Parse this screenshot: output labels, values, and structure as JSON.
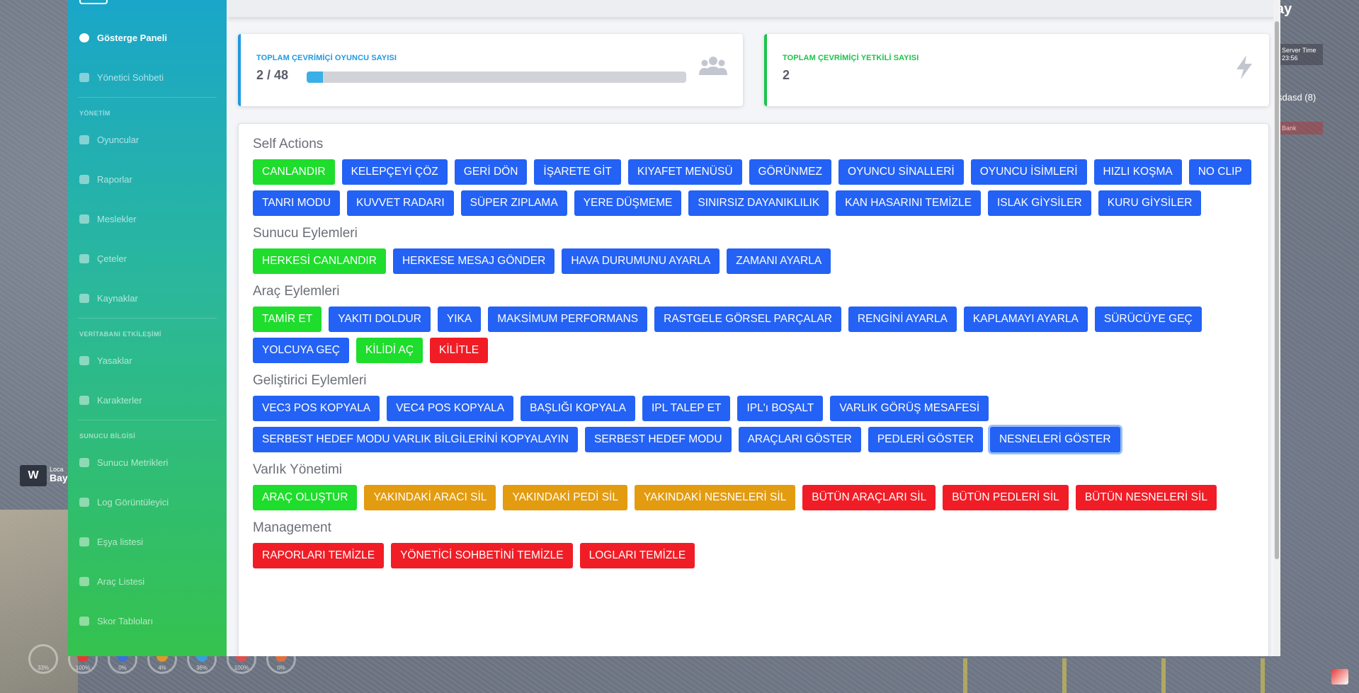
{
  "sidebar": {
    "items": [
      {
        "label": "Gösterge Paneli"
      },
      {
        "label": "Yönetici Sohbeti"
      },
      {
        "label": "Oyuncular"
      },
      {
        "label": "Raporlar"
      },
      {
        "label": "Meslekler"
      },
      {
        "label": "Çeteler"
      },
      {
        "label": "Kaynaklar"
      },
      {
        "label": "Yasaklar"
      },
      {
        "label": "Karakterler"
      },
      {
        "label": "Sunucu Metrikleri"
      },
      {
        "label": "Log Görüntüleyici"
      },
      {
        "label": "Eşya listesi"
      },
      {
        "label": "Araç Listesi"
      },
      {
        "label": "Skor Tabloları"
      }
    ],
    "headings": [
      "YÖNETİM",
      "VERİTABANI ETKİLEŞİMİ",
      "SUNUCU BİLGİSİ"
    ]
  },
  "stats": {
    "online_players_label": "TOPLAM ÇEVRİMİÇİ OYUNCU SAYISI",
    "online_players_value": "2 / 48",
    "online_players_fraction": 0.042,
    "online_admins_label": "TOPLAM ÇEVRİMİÇİ YETKİLİ SAYISI",
    "online_admins_value": "2"
  },
  "sections": {
    "self": {
      "title": "Self Actions",
      "buttons": [
        "CANLANDIR",
        "KELEPÇEYİ ÇÖZ",
        "GERİ DÖN",
        "İŞARETE GİT",
        "KIYAFET MENÜSÜ",
        "GÖRÜNMEZ",
        "OYUNCU SİNALLERİ",
        "OYUNCU İSİMLERİ",
        "HIZLI KOŞMA",
        "NO CLIP",
        "TANRI MODU",
        "KUVVET RADARI",
        "SÜPER ZIPLAMA",
        "YERE DÜŞMEME",
        "SINIRSIZ DAYANIKLILIK",
        "KAN HASARINI TEMİZLE",
        "ISLAK GİYSİLER",
        "KURU GİYSİLER"
      ]
    },
    "server": {
      "title": "Sunucu Eylemleri",
      "buttons": [
        "HERKESİ CANLANDIR",
        "HERKESE MESAJ GÖNDER",
        "HAVA DURUMUNU AYARLA",
        "ZAMANI AYARLA"
      ]
    },
    "vehicle": {
      "title": "Araç Eylemleri",
      "buttons": [
        "TAMİR ET",
        "YAKITI DOLDUR",
        "YIKA",
        "MAKSİMUM PERFORMANS",
        "RASTGELE GÖRSEL PARÇALAR",
        "RENGİNİ AYARLA",
        "KAPLAMAYI AYARLA",
        "SÜRÜCÜYE GEÇ",
        "YOLCUYA GEÇ",
        "KİLİDİ AÇ",
        "KİLİTLE"
      ]
    },
    "developer": {
      "title": "Geliştirici Eylemleri",
      "buttons": [
        "VEC3 POS KOPYALA",
        "VEC4 POS KOPYALA",
        "BAŞLIĞI KOPYALA",
        "IPL TALEP ET",
        "IPL'ı BOŞALT",
        "VARLIK GÖRÜŞ MESAFESİ",
        "SERBEST HEDEF MODU VARLIK BİLGİLERİNİ KOPYALAYIN",
        "SERBEST HEDEF MODU",
        "ARAÇLARI GÖSTER",
        "PEDLERİ GÖSTER",
        "NESNELERİ GÖSTER"
      ]
    },
    "entity": {
      "title": "Varlık Yönetimi",
      "buttons": [
        "ARAÇ OLUŞTUR",
        "YAKINDAKİ ARACI SİL",
        "YAKINDAKİ PEDİ SİL",
        "YAKINDAKİ NESNELERİ SİL",
        "BÜTÜN ARAÇLARI SİL",
        "BÜTÜN PEDLERİ SİL",
        "BÜTÜN NESNELERİ SİL"
      ]
    },
    "management": {
      "title": "Management",
      "buttons": [
        "RAPORLARI TEMİZLE",
        "YÖNETİCİ SOHBETİNİ TEMİZLE",
        "LOGLARI TEMİZLE"
      ]
    }
  },
  "hud": {
    "compass": "W",
    "location_label": "Loca",
    "location_name": "Bay",
    "day": "ay",
    "server_time_label": "Server Time",
    "server_time": "23:56",
    "player": "sdasd (8)",
    "bank_label": "Bank",
    "status": [
      "33%",
      "100%",
      "0%",
      "4%",
      "36%",
      "100%",
      "0%"
    ]
  },
  "colors": {
    "primary_blue": "#2462f5",
    "success_green": "#1edd2c",
    "warning_orange": "#e39b10",
    "danger_red": "#f11d26"
  }
}
